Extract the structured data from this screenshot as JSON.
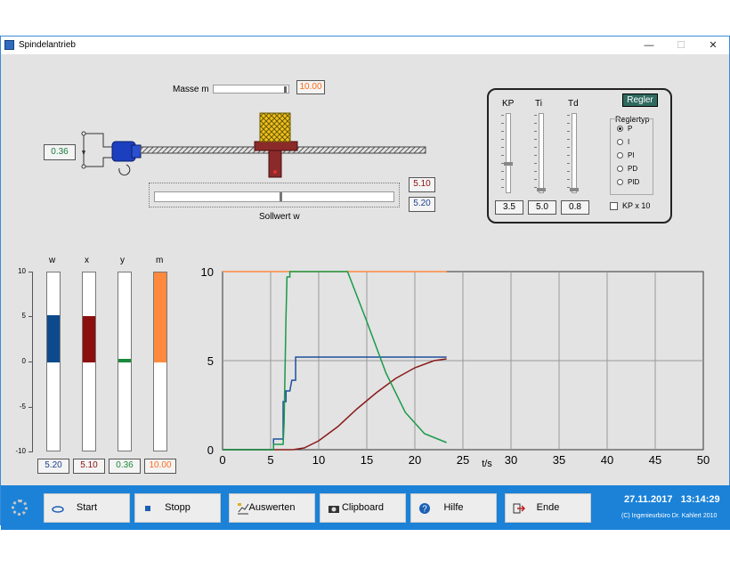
{
  "window": {
    "title": "Spindelantrieb",
    "controls": [
      "—",
      "☐",
      "✕"
    ]
  },
  "masse": {
    "label": "Masse m",
    "value": "10.00",
    "fraction": 1.0
  },
  "motor": {
    "value": "0.36"
  },
  "position": {
    "x_value": "5.10",
    "w_value": "5.20",
    "label": "Sollwert w",
    "fraction": 0.52
  },
  "regler": {
    "button": "Regler",
    "sliders": [
      {
        "label": "KP",
        "value": "3.5",
        "fraction": 0.35
      },
      {
        "label": "Ti",
        "value": "5.0",
        "fraction": 0.0
      },
      {
        "label": "Td",
        "value": "0.8",
        "fraction": 0.0
      }
    ],
    "group_label": "Reglertyp",
    "types": [
      {
        "label": "P",
        "selected": true
      },
      {
        "label": "I",
        "selected": false
      },
      {
        "label": "PI",
        "selected": false
      },
      {
        "label": "PD",
        "selected": false
      },
      {
        "label": "PID",
        "selected": false
      }
    ],
    "kp_checkbox": {
      "label": "KP x 10",
      "checked": false
    }
  },
  "bars": {
    "scale": [
      "10",
      "5",
      "0",
      "-5",
      "-10"
    ],
    "items": [
      {
        "label": "w",
        "value": "5.20",
        "num": 5.2,
        "color": "#0d4a8c",
        "text_color": "#1f3f8f"
      },
      {
        "label": "x",
        "value": "5.10",
        "num": 5.1,
        "color": "#8b0f0f",
        "text_color": "#8b0f0f"
      },
      {
        "label": "y",
        "value": "0.36",
        "num": 0.36,
        "color": "#1a8a3a",
        "text_color": "#1a8a3a"
      },
      {
        "label": "m",
        "value": "10.00",
        "num": 10.0,
        "color": "#ff8a3d",
        "text_color": "#ff6a1a"
      }
    ]
  },
  "chart_data": {
    "type": "line",
    "xlabel": "t/s",
    "ylabel": "",
    "title": "",
    "xlim": [
      0,
      50
    ],
    "ylim": [
      0,
      10
    ],
    "xticks": [
      "0",
      "5",
      "10",
      "15",
      "20",
      "25",
      "30",
      "35",
      "40",
      "45",
      "50"
    ],
    "yticks": [
      "0",
      "5",
      "10"
    ],
    "grid": true,
    "series": [
      {
        "color": "#ff8a3d",
        "x": [
          0,
          23.3
        ],
        "y": [
          10,
          10
        ]
      },
      {
        "color": "#1f4f9c",
        "x": [
          0,
          5.3,
          5.3,
          6.3,
          6.3,
          6.6,
          6.6,
          7.0,
          7.2,
          7.6,
          7.6,
          23.3
        ],
        "y": [
          0,
          0,
          0.6,
          0.6,
          2.7,
          2.7,
          3.3,
          3.3,
          3.9,
          3.9,
          5.2,
          5.2
        ]
      },
      {
        "color": "#8b1a1a",
        "x": [
          0,
          7.3,
          8.5,
          10,
          12,
          14,
          16,
          18,
          20,
          22,
          23.3
        ],
        "y": [
          0,
          0,
          0.1,
          0.5,
          1.3,
          2.3,
          3.2,
          4.0,
          4.6,
          5.0,
          5.1
        ]
      },
      {
        "color": "#1a9a4a",
        "x": [
          0,
          5.3,
          5.3,
          6.3,
          6.4,
          6.5,
          6.6,
          6.7,
          7.0,
          7.0,
          13.0,
          15,
          17,
          19,
          21,
          23.3
        ],
        "y": [
          0,
          0,
          0.3,
          0.3,
          1.5,
          4.5,
          7.5,
          9.7,
          9.7,
          10,
          10,
          7.2,
          4.3,
          2.1,
          0.9,
          0.4
        ]
      }
    ]
  },
  "toolbar": {
    "buttons": [
      {
        "name": "start-button",
        "icon": "start-icon",
        "label": "Start"
      },
      {
        "name": "stopp-button",
        "icon": "stop-icon",
        "label": "Stopp"
      },
      {
        "name": "auswerten-button",
        "icon": "evaluate-icon",
        "label": "Auswerten"
      },
      {
        "name": "clipboard-button",
        "icon": "camera-icon",
        "label": "Clipboard"
      },
      {
        "name": "hilfe-button",
        "icon": "help-icon",
        "label": "Hilfe"
      },
      {
        "name": "ende-button",
        "icon": "exit-icon",
        "label": "Ende"
      }
    ],
    "datetime": "27.11.2017   13:14:29",
    "copyright": "(C) Ingenieurbüro Dr. Kahlert 2010"
  }
}
